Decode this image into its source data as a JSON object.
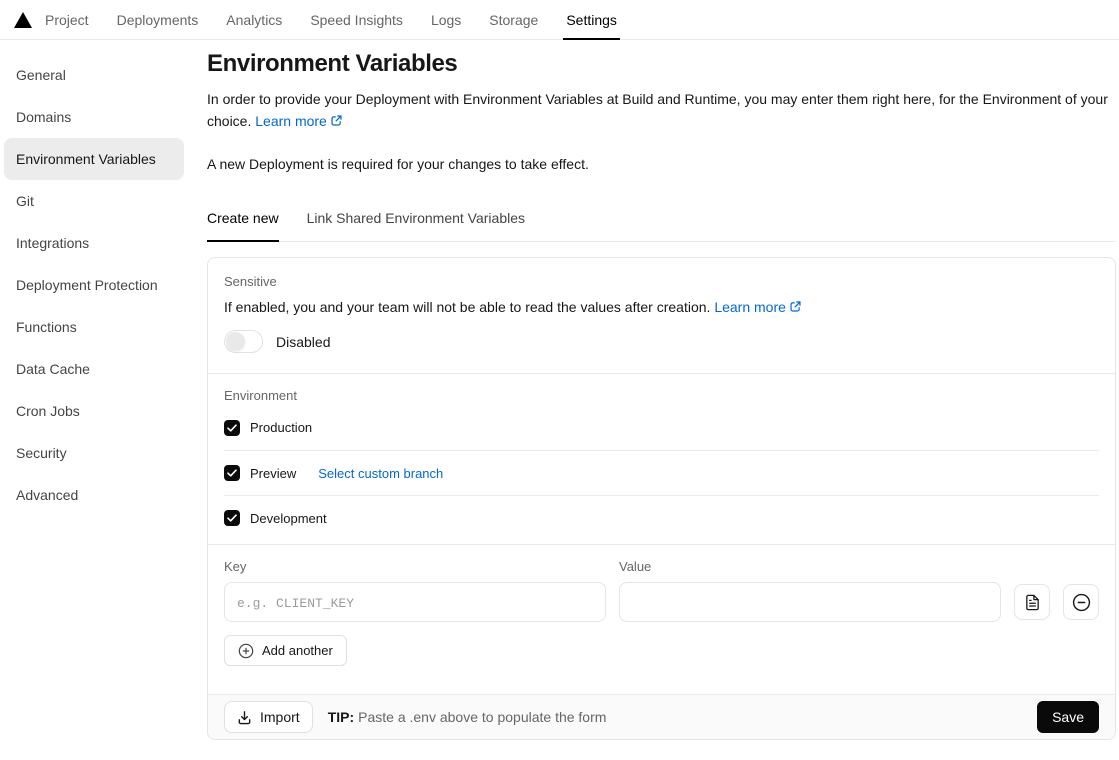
{
  "nav": {
    "logo": "vercel-triangle-logo",
    "items": [
      {
        "label": "Project",
        "active": false
      },
      {
        "label": "Deployments",
        "active": false
      },
      {
        "label": "Analytics",
        "active": false
      },
      {
        "label": "Speed Insights",
        "active": false
      },
      {
        "label": "Logs",
        "active": false
      },
      {
        "label": "Storage",
        "active": false
      },
      {
        "label": "Settings",
        "active": true
      }
    ]
  },
  "sidebar": {
    "items": [
      {
        "label": "General",
        "active": false
      },
      {
        "label": "Domains",
        "active": false
      },
      {
        "label": "Environment Variables",
        "active": true
      },
      {
        "label": "Git",
        "active": false
      },
      {
        "label": "Integrations",
        "active": false
      },
      {
        "label": "Deployment Protection",
        "active": false
      },
      {
        "label": "Functions",
        "active": false
      },
      {
        "label": "Data Cache",
        "active": false
      },
      {
        "label": "Cron Jobs",
        "active": false
      },
      {
        "label": "Security",
        "active": false
      },
      {
        "label": "Advanced",
        "active": false
      }
    ]
  },
  "main": {
    "title": "Environment Variables",
    "description": "In order to provide your Deployment with Environment Variables at Build and Runtime, you may enter them right here, for the Environment of your choice.",
    "description_link": "Learn more",
    "deploy_note": "A new Deployment is required for your changes to take effect.",
    "tabs": [
      {
        "label": "Create new",
        "active": true
      },
      {
        "label": "Link Shared Environment Variables",
        "active": false
      }
    ]
  },
  "card": {
    "sensitive": {
      "label": "Sensitive",
      "text": "If enabled, you and your team will not be able to read the values after creation.",
      "link": "Learn more",
      "toggle_state": "Disabled",
      "toggle_on": false
    },
    "environment": {
      "label": "Environment",
      "options": [
        {
          "label": "Production",
          "checked": true
        },
        {
          "label": "Preview",
          "checked": true,
          "link": "Select custom branch"
        },
        {
          "label": "Development",
          "checked": true
        }
      ]
    },
    "kv": {
      "key_label": "Key",
      "key_placeholder": "e.g. CLIENT_KEY",
      "key_value": "",
      "value_label": "Value",
      "value_value": "",
      "add_another_label": "Add another"
    },
    "footer": {
      "import_label": "Import",
      "tip_label": "TIP:",
      "tip_text": "Paste a .env above to populate the form",
      "save_label": "Save"
    }
  },
  "colors": {
    "link_blue": "#0068d6",
    "accent_black": "#0a0a0a",
    "border": "#e5e5e5",
    "muted_text": "#666666",
    "active_item_bg": "#ececec"
  }
}
